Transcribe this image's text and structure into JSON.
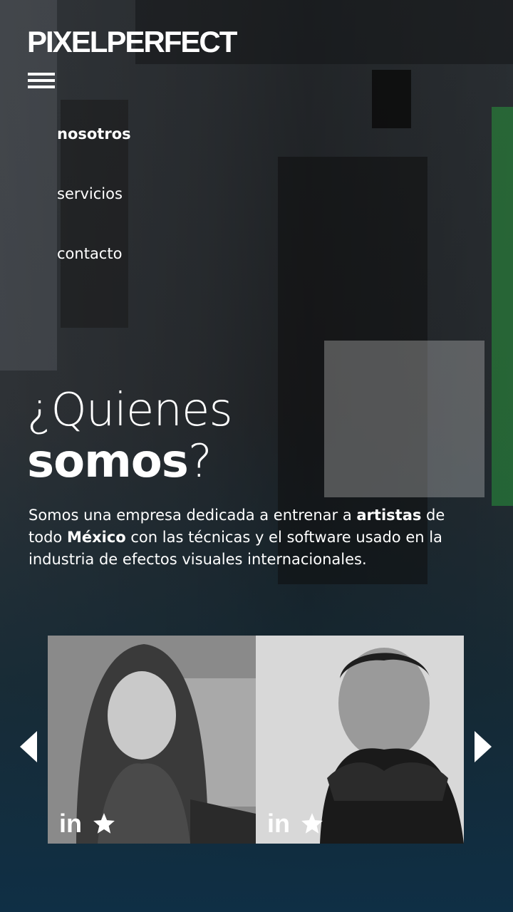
{
  "brand": {
    "name": "PIXELPERFECT"
  },
  "nav": {
    "items": [
      {
        "label": "nosotros",
        "active": true
      },
      {
        "label": "servicios",
        "active": false
      },
      {
        "label": "contacto",
        "active": false
      }
    ]
  },
  "hero": {
    "heading_line1": "¿Quienes",
    "heading_line2_bold": "somos",
    "heading_line2_tail": "?",
    "description": {
      "part1": "Somos una empresa dedicada a entrenar a ",
      "bold1": "artistas",
      "part2": " de todo ",
      "bold2": "México",
      "part3": " con las técnicas y el software usado en la industria de efectos visuales internacionales."
    }
  },
  "team": {
    "members": [
      {
        "linkedin_label": "in"
      },
      {
        "linkedin_label": "in"
      }
    ]
  },
  "icons": {
    "menu": "hamburger-icon",
    "prev": "arrow-left-icon",
    "next": "arrow-right-icon",
    "linkedin": "linkedin-icon",
    "star": "star-icon"
  },
  "colors": {
    "text": "#ffffff",
    "bottom_tint": "#0f2f45"
  }
}
